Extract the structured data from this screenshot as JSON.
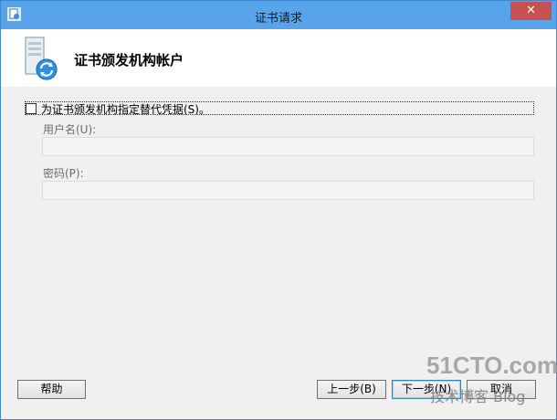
{
  "window": {
    "title": "证书请求",
    "close_label": "✕"
  },
  "header": {
    "title": "证书颁发机构帐户",
    "icon": "server-certificate-icon"
  },
  "form": {
    "alt_credentials_label": "为证书颁发机构指定替代凭据(S)。",
    "alt_credentials_checked": false,
    "username_label": "用户名(U):",
    "username_value": "",
    "password_label": "密码(P):",
    "password_value": ""
  },
  "buttons": {
    "help": "帮助",
    "back": "上一步(B)",
    "next": "下一步(N)",
    "cancel": "取消"
  },
  "watermark": {
    "site": "51CTO.com",
    "tagline": "技术博客 Blog"
  },
  "colors": {
    "titlebar": "#58a4ea",
    "close": "#c75050",
    "dialog_bg": "#f0f0f0"
  }
}
